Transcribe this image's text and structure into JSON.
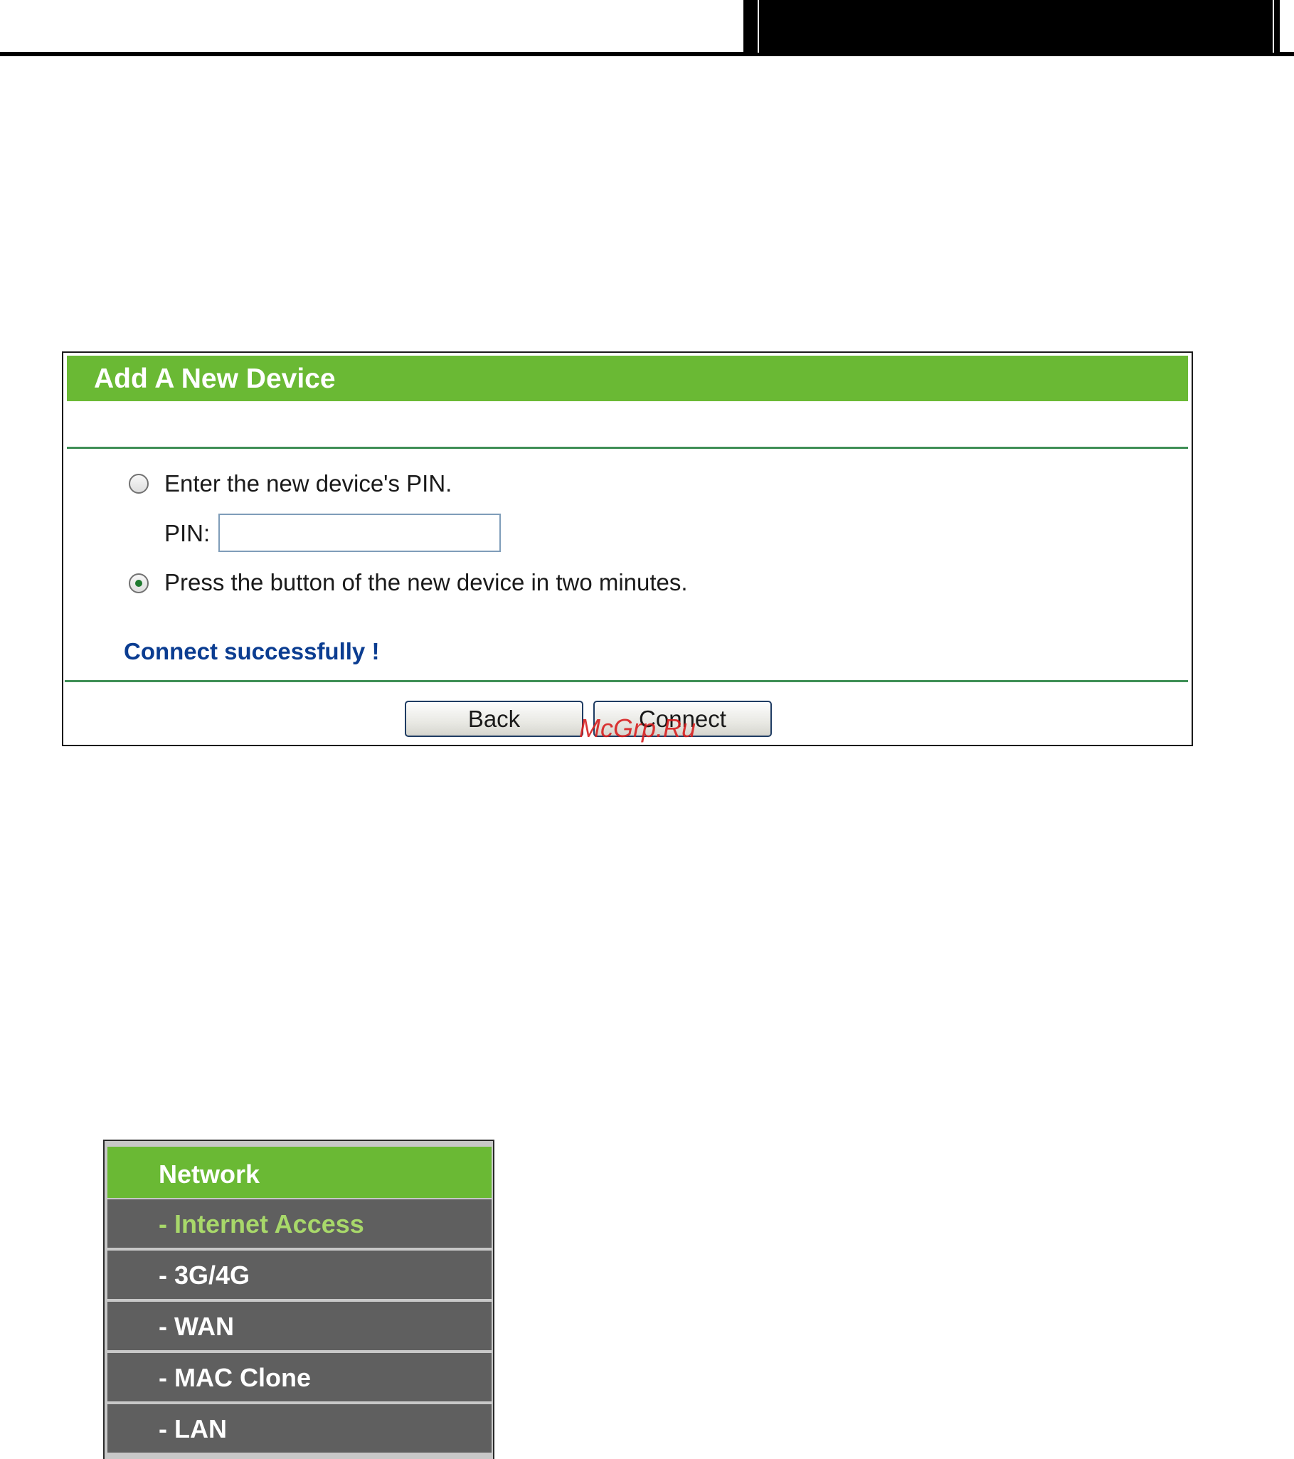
{
  "wps_panel": {
    "title": "Add A New Device",
    "option_pin_label": "Enter the new device's PIN.",
    "pin_field_label": "PIN:",
    "pin_value": "",
    "option_press_label": "Press the button of the new device in two minutes.",
    "selected_option": "press",
    "status_message": "Connect successfully !",
    "back_label": "Back",
    "connect_label": "Connect"
  },
  "watermark": "McGrp.Ru",
  "sidebar": {
    "header": "Network",
    "items": [
      {
        "label": "- Internet Access",
        "active": true
      },
      {
        "label": "- 3G/4G",
        "active": false
      },
      {
        "label": "- WAN",
        "active": false
      },
      {
        "label": "- MAC Clone",
        "active": false
      },
      {
        "label": "- LAN",
        "active": false
      }
    ]
  },
  "colors": {
    "accent_green": "#6ab934",
    "rule_green": "#3f8f56",
    "status_blue": "#0b3d91",
    "menu_gray": "#5f5f5f",
    "menu_active_text": "#a8d86a",
    "watermark_red": "#d82020"
  }
}
